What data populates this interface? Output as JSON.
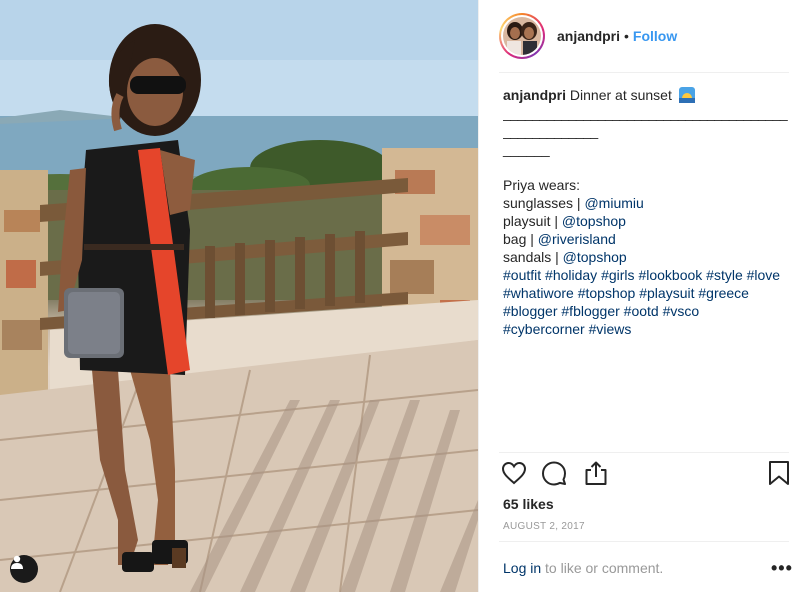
{
  "post": {
    "username": "anjandpri",
    "follow_label": "Follow",
    "separator": "•"
  },
  "caption": {
    "username": "anjandpri",
    "headline": "Dinner at sunset",
    "dashes": "____________________________________________________",
    "dashes_tail": "______",
    "intro": "Priya wears:",
    "items": [
      {
        "label": "sunglasses | ",
        "link": "@miumiu"
      },
      {
        "label": "playsuit | ",
        "link": "@topshop"
      },
      {
        "label": "bag | ",
        "link": "@riverisland"
      },
      {
        "label": "sandals | ",
        "link": "@topshop"
      }
    ],
    "hashtag_lines": [
      [
        "#outfit",
        "#holiday",
        "#girls",
        "#lookbook",
        "#style",
        "#love"
      ],
      [
        "#whatiwore",
        "#topshop",
        "#playsuit",
        "#greece"
      ],
      [
        "#blogger",
        "#fblogger",
        "#ootd",
        "#vsco"
      ],
      [
        "#cybercorner",
        "#views"
      ]
    ]
  },
  "stats": {
    "likes": "65 likes",
    "date": "AUGUST 2, 2017"
  },
  "comment": {
    "login_link": "Log in",
    "login_suffix": " to like or comment.",
    "more_label": "•••"
  },
  "icons": {
    "like": "heart-icon",
    "comment": "comment-icon",
    "share": "share-icon",
    "save": "bookmark-icon",
    "user_tag": "user-icon",
    "sunset_emoji": "sunset-emoji-icon",
    "more": "more-options-icon"
  },
  "colors": {
    "link": "#3897f0",
    "mention": "#003569",
    "muted": "#999999",
    "text": "#262626"
  }
}
